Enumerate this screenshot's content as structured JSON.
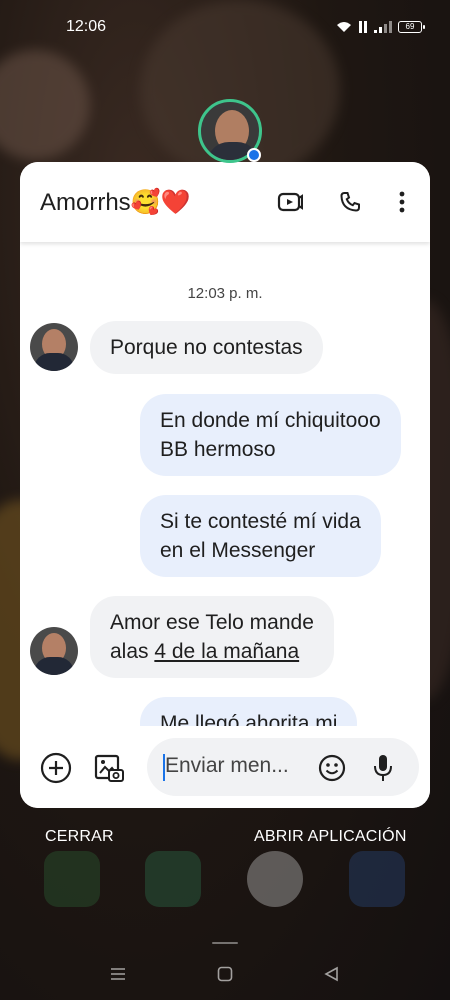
{
  "status_bar": {
    "time": "12:06",
    "battery_level": "69"
  },
  "chat": {
    "contact_name": "Amorrhs🥰❤️",
    "timestamp": "12:03 p. m.",
    "messages": [
      {
        "direction": "incoming",
        "text": "Porque no contestas"
      },
      {
        "direction": "outgoing",
        "lines": [
          "En donde mí chiquitooo",
          "BB hermoso"
        ]
      },
      {
        "direction": "outgoing",
        "lines": [
          "Si te contesté mí vida",
          "en el Messenger"
        ]
      },
      {
        "direction": "incoming",
        "line1": "Amor ese Telo mande",
        "line2_prefix": "alas ",
        "line2_link": "4 de la mañana"
      },
      {
        "direction": "outgoing",
        "text": "Me llegó ahorita mi"
      }
    ],
    "composer": {
      "placeholder": "Enviar men..."
    }
  },
  "bubble_actions": {
    "close_label": "CERRAR",
    "open_app_label": "ABRIR APLICACIÓN"
  },
  "colors": {
    "outgoing_bubble": "#e8effc",
    "incoming_bubble": "#f1f2f4",
    "bubble_ring": "#3ec58c",
    "accent": "#1a73e8"
  },
  "icons": {
    "header": [
      "video-call-icon",
      "phone-icon",
      "more-vert-icon"
    ],
    "composer": [
      "add-icon",
      "gallery-icon",
      "emoji-icon",
      "mic-icon"
    ],
    "navigation": [
      "recents-icon",
      "home-icon",
      "back-icon"
    ]
  }
}
